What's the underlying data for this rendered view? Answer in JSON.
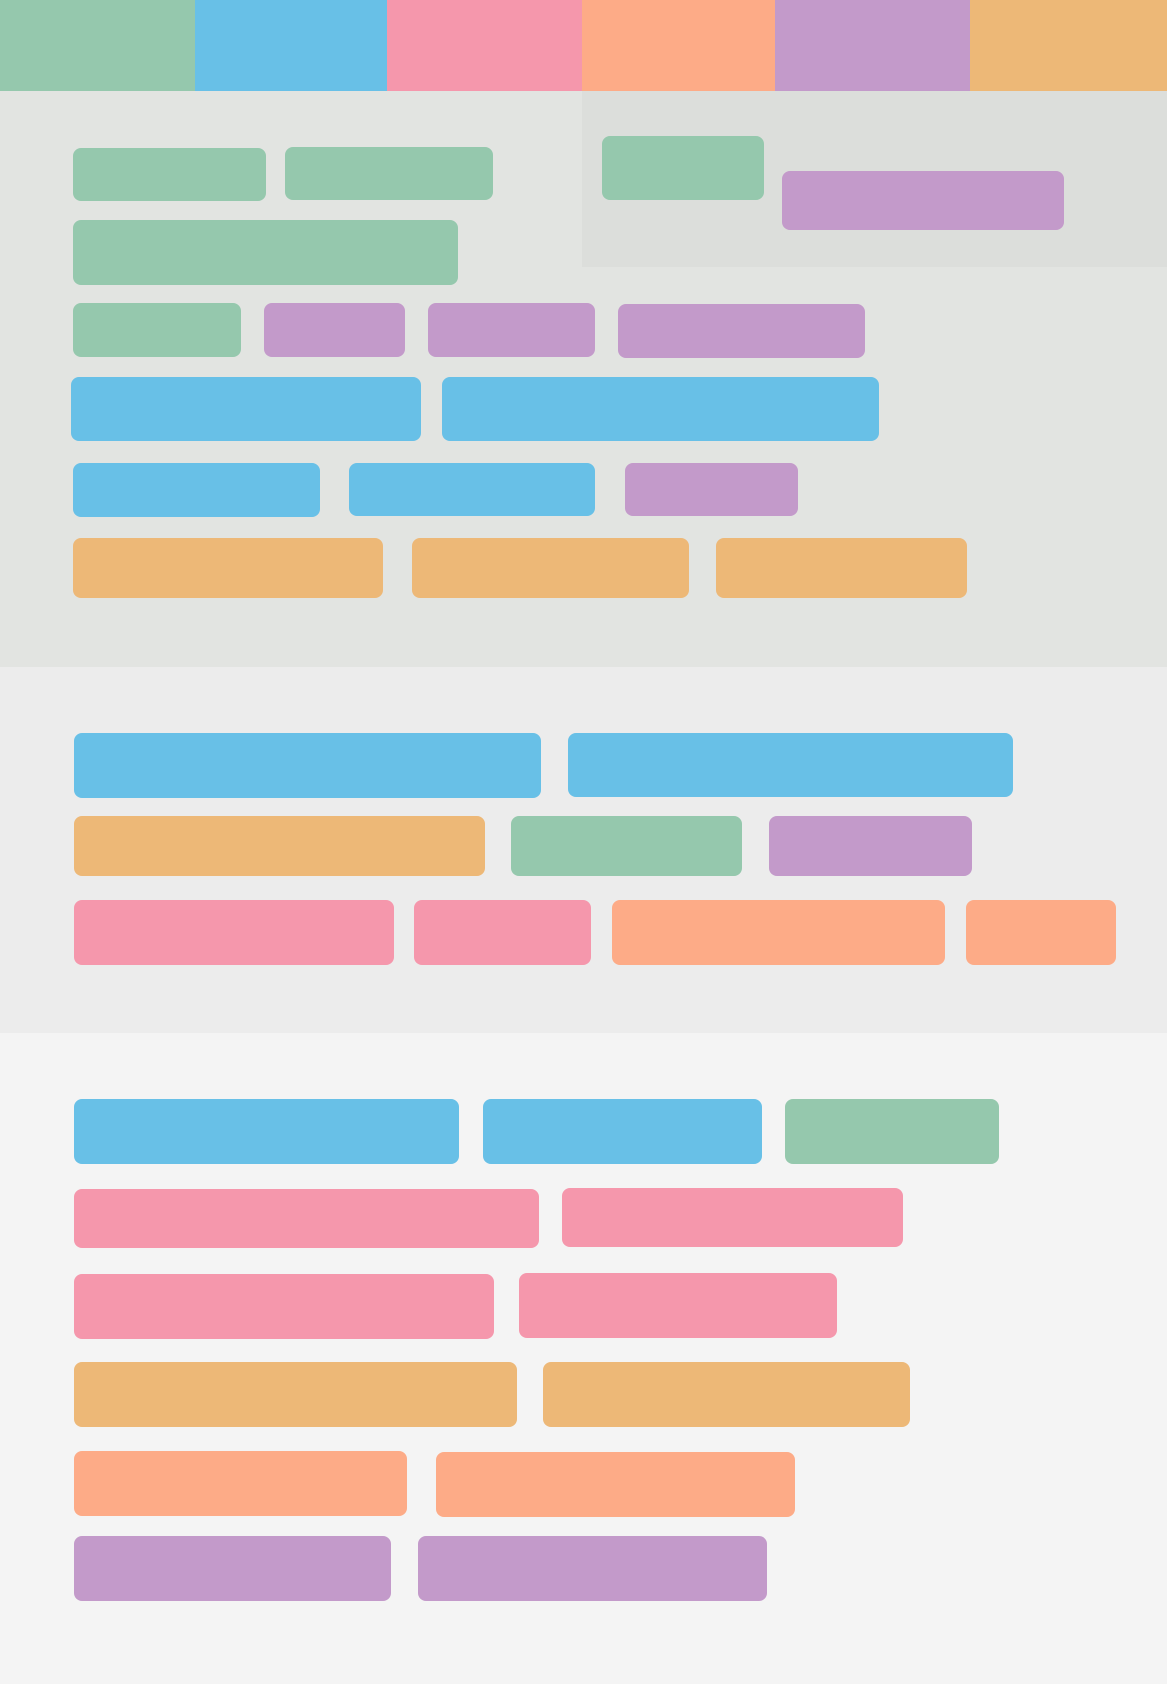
{
  "palette": {
    "green": "#95c8ad",
    "blue": "#68c0e7",
    "pink": "#f597ac",
    "salmon": "#fdab87",
    "purple": "#c39aca",
    "orange": "#edb877"
  },
  "top_bar": {
    "swatches": [
      "green",
      "blue",
      "pink",
      "salmon",
      "purple",
      "orange"
    ]
  },
  "section_colors": {
    "section_1": "#e2e4e1",
    "section_1_inset": "#dcdedb",
    "section_2": "#ececec",
    "section_3": "#f4f4f4"
  }
}
